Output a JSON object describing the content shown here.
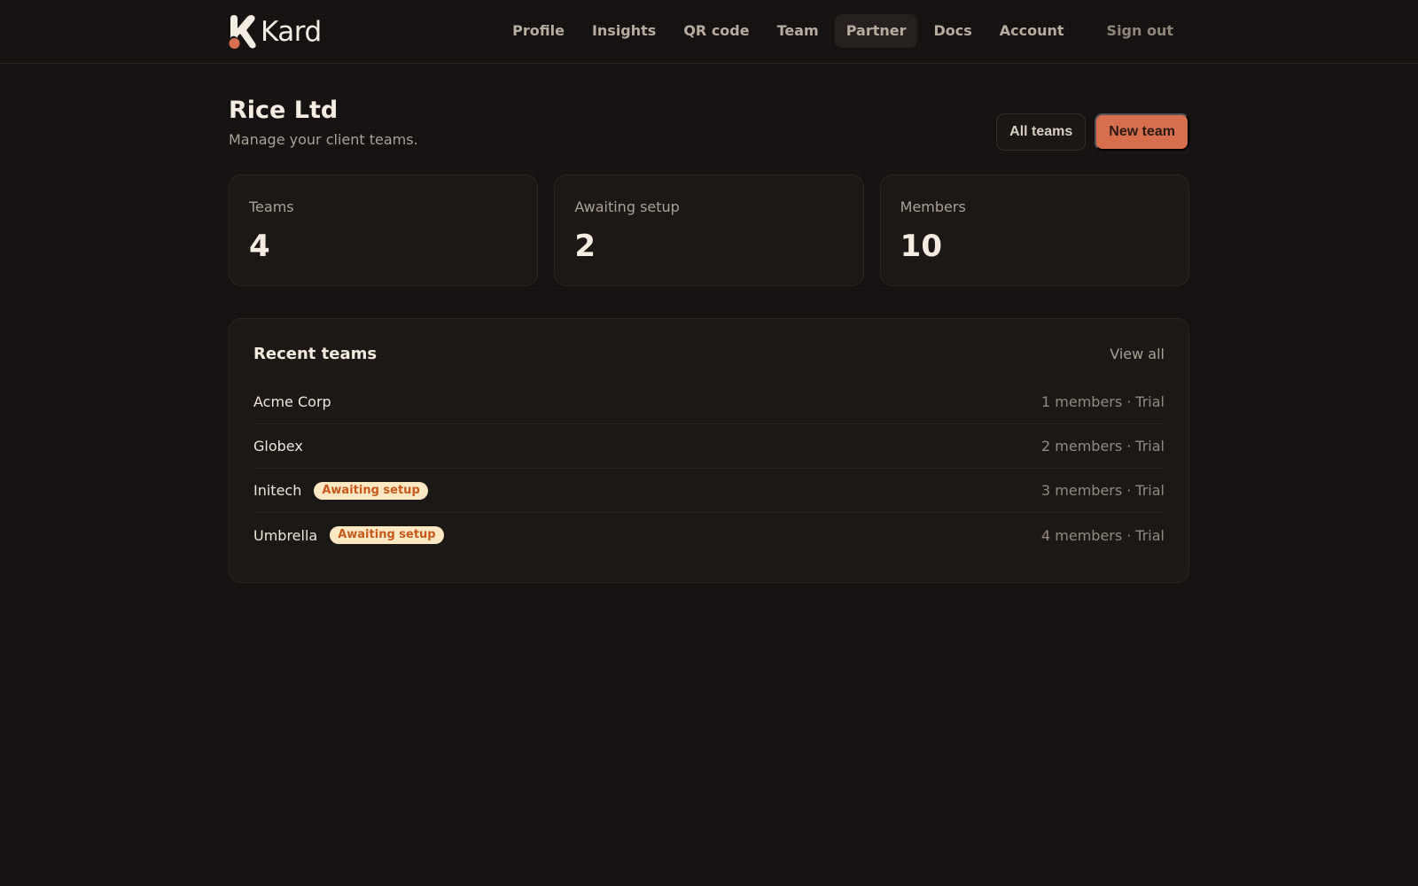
{
  "brand": {
    "name": "Kard",
    "accent": "#d76f4f"
  },
  "nav": {
    "items": [
      {
        "label": "Profile",
        "active": false
      },
      {
        "label": "Insights",
        "active": false
      },
      {
        "label": "QR code",
        "active": false
      },
      {
        "label": "Team",
        "active": false
      },
      {
        "label": "Partner",
        "active": true
      },
      {
        "label": "Docs",
        "active": false
      },
      {
        "label": "Account",
        "active": false
      }
    ],
    "signout": "Sign out"
  },
  "page": {
    "title": "Rice Ltd",
    "subtitle": "Manage your client teams.",
    "actions": {
      "all_teams": "All teams",
      "new_team": "New team"
    }
  },
  "stats": [
    {
      "label": "Teams",
      "value": "4"
    },
    {
      "label": "Awaiting setup",
      "value": "2"
    },
    {
      "label": "Members",
      "value": "10"
    }
  ],
  "recent": {
    "title": "Recent teams",
    "view_all": "View all",
    "separator": "·",
    "rows": [
      {
        "name": "Acme Corp",
        "badge": "",
        "members": "1 members",
        "plan": "Trial"
      },
      {
        "name": "Globex",
        "badge": "",
        "members": "2 members",
        "plan": "Trial"
      },
      {
        "name": "Initech",
        "badge": "Awaiting setup",
        "members": "3 members",
        "plan": "Trial"
      },
      {
        "name": "Umbrella",
        "badge": "Awaiting setup",
        "members": "4 members",
        "plan": "Trial"
      }
    ]
  }
}
